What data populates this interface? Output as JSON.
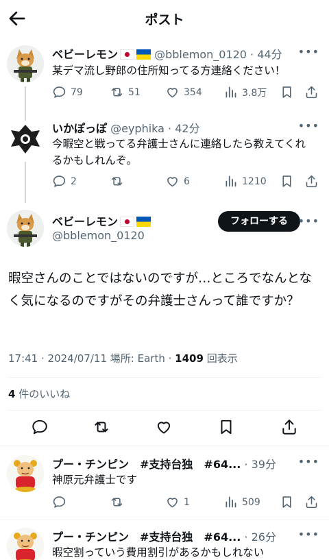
{
  "header": {
    "title": "ポスト"
  },
  "tweets": [
    {
      "name": "ベビーレモン",
      "handle": "@bblemon_0120",
      "time": "44分",
      "text": "某デマ流し野郎の住所知ってる方連絡ください！",
      "replies": "79",
      "retweets": "51",
      "likes": "354",
      "views": "3.8万"
    },
    {
      "name": "いかぽっぽ",
      "handle": "@eyphika",
      "time": "42分",
      "text": "今暇空と戦ってる弁護士さんに連絡したら教えてくれるかもしれんぞ。",
      "replies": "2",
      "retweets": "",
      "likes": "6",
      "views": "1210"
    }
  ],
  "main": {
    "name": "ベビーレモン",
    "handle": "@bblemon_0120",
    "follow_label": "フォローする",
    "text": "暇空さんのことではないのですが…ところでなんとなく気になるのですがその弁護士さんって誰ですか？",
    "time": "17:41",
    "date": "2024/07/11",
    "location_label": "場所: Earth",
    "views_count": "1409",
    "views_label": "回表示",
    "likes_count": "4",
    "likes_label": "件のいいね"
  },
  "replies": [
    {
      "name": "プー・チンピン　#支持台独　#64...",
      "time": "39分",
      "text": "神原元弁護士です",
      "replies": "",
      "retweets": "",
      "likes": "1",
      "views": "509"
    },
    {
      "name": "プー・チンピン　#支持台独　#64...",
      "time": "26分",
      "text": "暇空割っていう費用割引があるかもしれない"
    }
  ],
  "icons": {
    "back": "arrow-left-icon",
    "reply": "comment-icon",
    "retweet": "retweet-icon",
    "like": "heart-icon",
    "views": "bar-chart-icon",
    "bookmark": "bookmark-icon",
    "share": "share-icon",
    "more": "more-dots-icon"
  },
  "colors": {
    "follow_bg": "#0f1419",
    "muted": "#536471",
    "divider": "#eff3f4"
  }
}
